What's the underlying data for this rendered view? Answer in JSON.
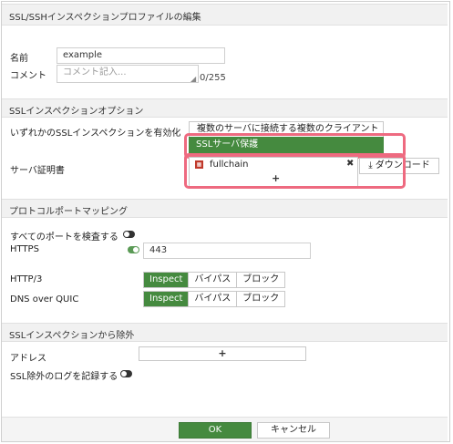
{
  "dialog": {
    "title": "SSL/SSHインスペクションプロファイルの編集"
  },
  "general": {
    "name_label": "名前",
    "name_value": "example",
    "comment_label": "コメント",
    "comment_placeholder": "コメント記入...",
    "comment_counter": "0/255"
  },
  "ssl_options": {
    "header": "SSLインスペクションオプション",
    "enable_label": "いずれかのSSLインスペクションを有効化",
    "option_multi_client": "複数のサーバに接続する複数のクライアント",
    "option_server_protection": "SSLサーバ保護",
    "server_cert_label": "サーバ証明書",
    "cert_name": "fullchain",
    "download_label": "ダウンロード",
    "add_symbol": "+",
    "remove_symbol": "✖"
  },
  "port_mapping": {
    "header": "プロトコルポートマッピング",
    "inspect_all_label": "すべてのポートを検査する",
    "https_label": "HTTPS",
    "https_port": "443",
    "http3_label": "HTTP/3",
    "dns_quic_label": "DNS over QUIC",
    "options": [
      "Inspect",
      "バイパス",
      "ブロック"
    ],
    "http3_selected": "Inspect",
    "dns_quic_selected": "Inspect"
  },
  "exemptions": {
    "header": "SSLインスペクションから除外",
    "address_label": "アドレス",
    "address_add_symbol": "+",
    "log_label": "SSL除外のログを記録する"
  },
  "footer": {
    "ok_label": "OK",
    "cancel_label": "キャンセル"
  },
  "colors": {
    "accent_green": "#458a3f",
    "highlight_pink": "#ee6a80"
  }
}
